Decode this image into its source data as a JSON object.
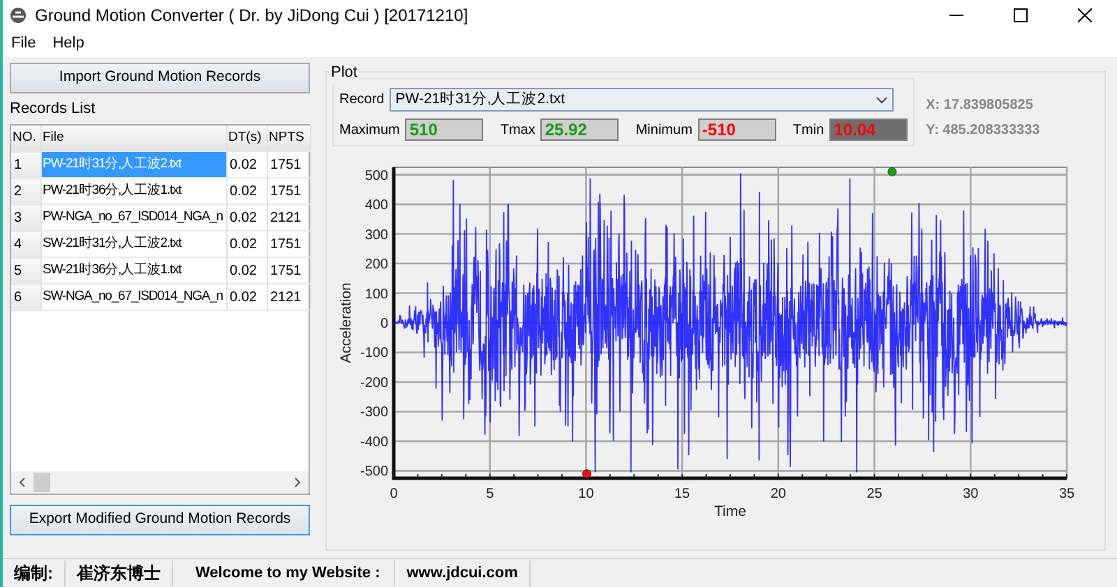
{
  "window": {
    "title": "Ground Motion Converter ( Dr. by JiDong Cui ) [20171210]"
  },
  "menu": [
    "File",
    "Help"
  ],
  "left_panel": {
    "import_button": "Import Ground Motion Records",
    "records_list": {
      "title": "Records List",
      "columns": [
        "NO.",
        "File",
        "DT(s)",
        "NPTS"
      ],
      "rows": [
        {
          "no": "1",
          "file": "PW-21时31分,人工波2.txt",
          "dt": "0.02",
          "npts": "1751",
          "selected": true
        },
        {
          "no": "2",
          "file": "PW-21时36分,人工波1.txt",
          "dt": "0.02",
          "npts": "1751",
          "selected": false
        },
        {
          "no": "3",
          "file": "PW-NGA_no_67_ISD014_NGA_n",
          "dt": "0.02",
          "npts": "2121",
          "selected": false
        },
        {
          "no": "4",
          "file": "SW-21时31分,人工波2.txt",
          "dt": "0.02",
          "npts": "1751",
          "selected": false
        },
        {
          "no": "5",
          "file": "SW-21时36分,人工波1.txt",
          "dt": "0.02",
          "npts": "1751",
          "selected": false
        },
        {
          "no": "6",
          "file": "SW-NGA_no_67_ISD014_NGA_n",
          "dt": "0.02",
          "npts": "2121",
          "selected": false
        }
      ]
    },
    "export_button": "Export Modified Ground Motion Records"
  },
  "plot": {
    "title": "Plot",
    "record": {
      "label": "Record",
      "value": "PW-21时31分,人工波2.txt"
    },
    "stats": [
      {
        "label": "Maximum",
        "value": "510",
        "color": "#1a9a1a",
        "shaded": false
      },
      {
        "label": "Tmax",
        "value": "25.92",
        "color": "#1a9a1a",
        "shaded": false
      },
      {
        "label": "Minimum",
        "value": "-510",
        "color": "#ff0000",
        "shaded": false
      },
      {
        "label": "Tmin",
        "value": "10.04",
        "color": "#ff0000",
        "shaded": true
      }
    ],
    "cursor": [
      "X: 17.839805825",
      "Y: 485.208333333"
    ],
    "axes": {
      "ylabel": "Acceleration",
      "xlabel": "Time",
      "yticks": [
        "500",
        "400",
        "300",
        "200",
        "100",
        "0",
        "-100",
        "-200",
        "-300",
        "-400",
        "-500"
      ],
      "xticks": [
        "0",
        "5",
        "10",
        "15",
        "20",
        "25",
        "30",
        "35"
      ]
    }
  },
  "status_bar": [
    "编制:",
    "崔济东博士",
    "Welcome to my Website :",
    "www.jdcui.com"
  ]
}
